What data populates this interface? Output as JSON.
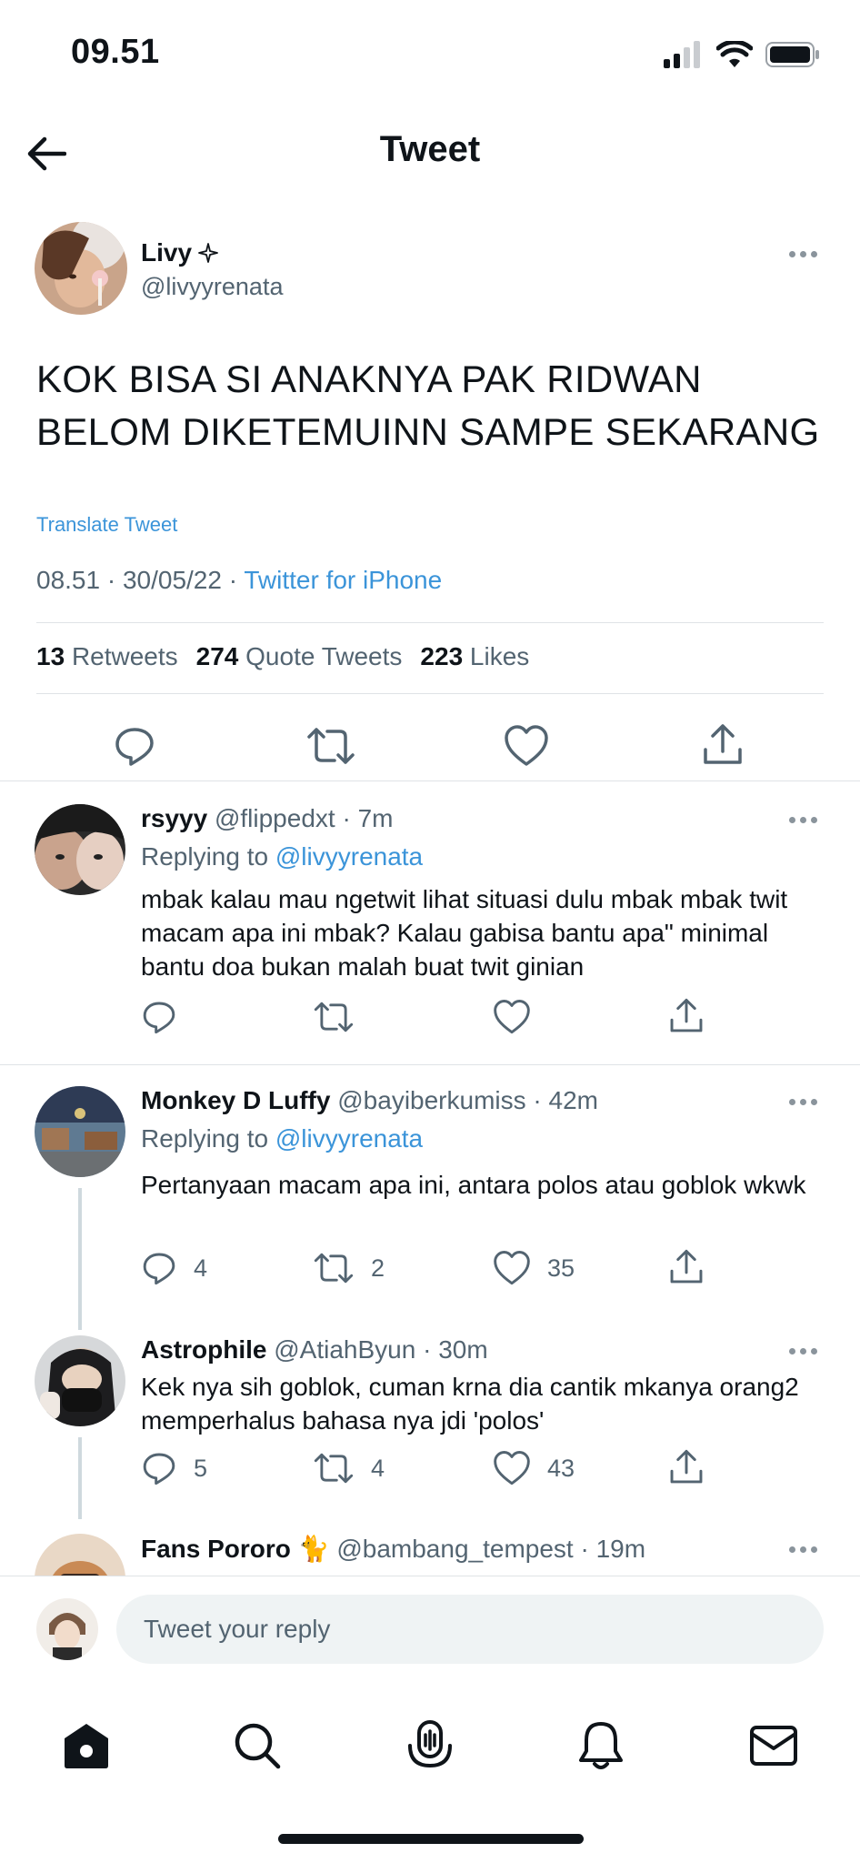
{
  "status_bar": {
    "time": "09.51"
  },
  "header": {
    "title": "Tweet"
  },
  "main_tweet": {
    "author_name": "Livy",
    "author_handle": "@livyyrenata",
    "text_line1": "KOK BISA SI ANAKNYA PAK RIDWAN",
    "text_line2": "BELOM DIKETEMUINN SAMPE SEKARANG",
    "translate": "Translate Tweet",
    "time_date": "08.51 · 30/05/22 ·",
    "source": "Twitter for iPhone",
    "retweets_count": "13",
    "retweets_label": "Retweets",
    "quotes_count": "274",
    "quotes_label": "Quote Tweets",
    "likes_count": "223",
    "likes_label": "Likes"
  },
  "replies": [
    {
      "name": "rsyyy",
      "handle_time": "@flippedxt · 7m",
      "replying_prefix": "Replying to",
      "replying_handle": "@livyyrenata",
      "text": "mbak kalau mau ngetwit lihat situasi dulu mbak mbak twit macam apa ini mbak? Kalau gabisa bantu apa\" minimal bantu doa bukan malah buat twit ginian",
      "reply_count": "",
      "retweet_count": "",
      "like_count": ""
    },
    {
      "name": "Monkey D Luffy",
      "handle_time": "@bayiberkumiss · 42m",
      "replying_prefix": "Replying to",
      "replying_handle": "@livyyrenata",
      "text": "Pertanyaan macam apa ini, antara polos atau goblok wkwk",
      "reply_count": "4",
      "retweet_count": "2",
      "like_count": "35"
    },
    {
      "name": "Astrophile",
      "handle_time": "@AtiahByun · 30m",
      "text": "Kek nya sih goblok, cuman krna dia cantik mkanya orang2 memperhalus bahasa nya jdi 'polos'",
      "reply_count": "5",
      "retweet_count": "4",
      "like_count": "43"
    },
    {
      "name": "Fans Pororo 🐈",
      "handle_time": "@bambang_tempest · 19m"
    }
  ],
  "reply_bar": {
    "placeholder": "Tweet your reply"
  },
  "colors": {
    "link": "#3b94d9",
    "text": "#0f1419",
    "muted": "#536471"
  }
}
